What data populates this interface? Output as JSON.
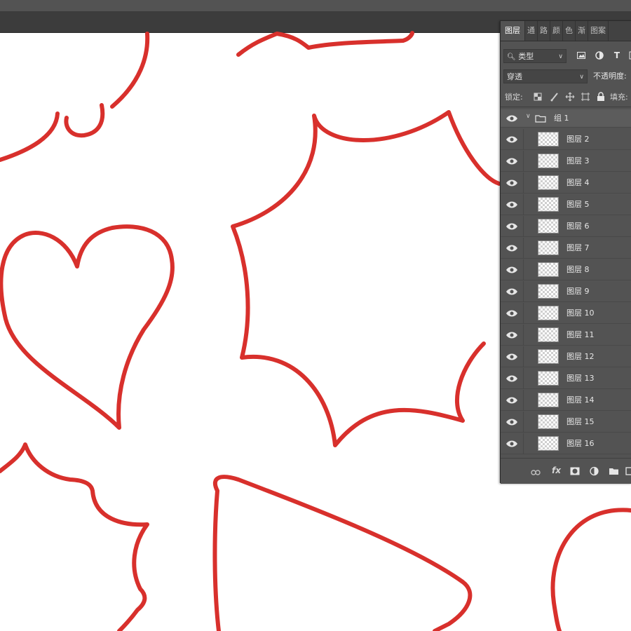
{
  "panel": {
    "tabs": [
      "图层",
      "通",
      "路",
      "颜",
      "色",
      "渐",
      "图案"
    ],
    "filter": {
      "kind_label": "类型",
      "icons": [
        "image-filter-icon",
        "adjustment-filter-icon",
        "type-filter-icon",
        "shape-filter-icon"
      ],
      "type_glyph": "T"
    },
    "blend_mode": "穿透",
    "opacity_label": "不透明度:",
    "lock_label": "锁定:",
    "fill_label": "填充:",
    "group": {
      "name": "组 1"
    },
    "layers": [
      "图层 2",
      "图层 3",
      "图层 4",
      "图层 5",
      "图层 6",
      "图层 7",
      "图层 8",
      "图层 9",
      "图层 10",
      "图层 11",
      "图层 12",
      "图层 13",
      "图层 14",
      "图层 15",
      "图层 16"
    ],
    "bottom_fx": "fx"
  },
  "colors": {
    "stroke": "#d8302c",
    "panel_bg": "#535353"
  }
}
